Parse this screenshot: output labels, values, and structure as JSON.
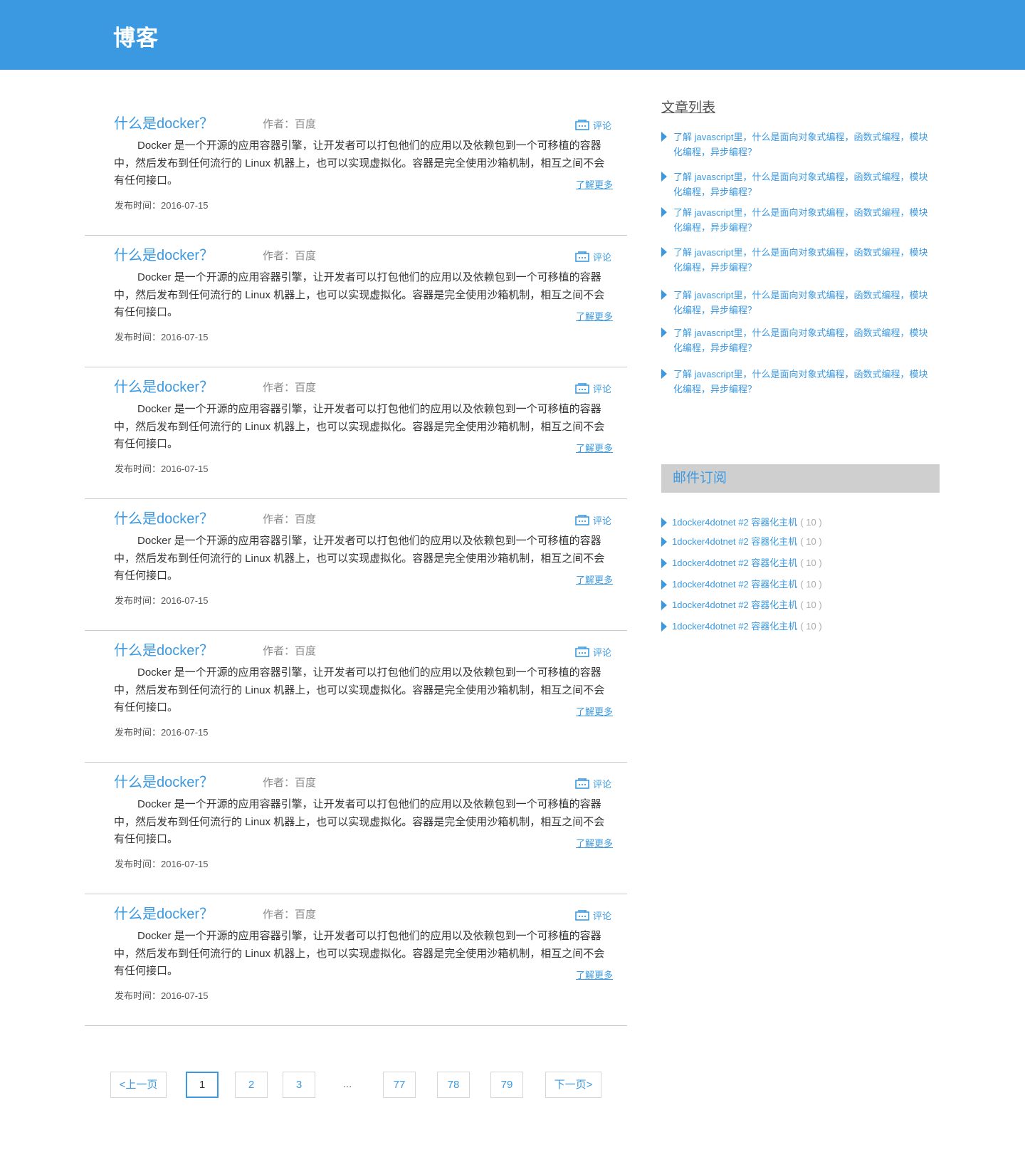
{
  "header": {
    "site_title": "博客"
  },
  "posts": [
    {
      "title": "什么是docker？",
      "author": "作者：百度",
      "comment_label": "评论",
      "excerpt": "Docker 是一个开源的应用容器引擎，让开发者可以打包他们的应用以及依赖包到一个可移植的容器中，然后发布到任何流行的 Linux 机器上，也可以实现虚拟化。容器是完全使用沙箱机制，相互之间不会有任何接口。",
      "more_label": "了解更多",
      "date": "发布时间：2016-07-15"
    },
    {
      "title": "什么是docker？",
      "author": "作者：百度",
      "comment_label": "评论",
      "excerpt": "Docker 是一个开源的应用容器引擎，让开发者可以打包他们的应用以及依赖包到一个可移植的容器中，然后发布到任何流行的 Linux 机器上，也可以实现虚拟化。容器是完全使用沙箱机制，相互之间不会有任何接口。",
      "more_label": "了解更多",
      "date": "发布时间：2016-07-15"
    },
    {
      "title": "什么是docker？",
      "author": "作者：百度",
      "comment_label": "评论",
      "excerpt": "Docker 是一个开源的应用容器引擎，让开发者可以打包他们的应用以及依赖包到一个可移植的容器中，然后发布到任何流行的 Linux 机器上，也可以实现虚拟化。容器是完全使用沙箱机制，相互之间不会有任何接口。",
      "more_label": "了解更多",
      "date": "发布时间：2016-07-15"
    },
    {
      "title": "什么是docker？",
      "author": "作者：百度",
      "comment_label": "评论",
      "excerpt": "Docker 是一个开源的应用容器引擎，让开发者可以打包他们的应用以及依赖包到一个可移植的容器中，然后发布到任何流行的 Linux 机器上，也可以实现虚拟化。容器是完全使用沙箱机制，相互之间不会有任何接口。",
      "more_label": "了解更多",
      "date": "发布时间：2016-07-15"
    },
    {
      "title": "什么是docker？",
      "author": "作者：百度",
      "comment_label": "评论",
      "excerpt": "Docker 是一个开源的应用容器引擎，让开发者可以打包他们的应用以及依赖包到一个可移植的容器中，然后发布到任何流行的 Linux 机器上，也可以实现虚拟化。容器是完全使用沙箱机制，相互之间不会有任何接口。",
      "more_label": "了解更多",
      "date": "发布时间：2016-07-15"
    },
    {
      "title": "什么是docker？",
      "author": "作者：百度",
      "comment_label": "评论",
      "excerpt": "Docker 是一个开源的应用容器引擎，让开发者可以打包他们的应用以及依赖包到一个可移植的容器中，然后发布到任何流行的 Linux 机器上，也可以实现虚拟化。容器是完全使用沙箱机制，相互之间不会有任何接口。",
      "more_label": "了解更多",
      "date": "发布时间：2016-07-15"
    },
    {
      "title": "什么是docker？",
      "author": "作者：百度",
      "comment_label": "评论",
      "excerpt": "Docker 是一个开源的应用容器引擎，让开发者可以打包他们的应用以及依赖包到一个可移植的容器中，然后发布到任何流行的 Linux 机器上，也可以实现虚拟化。容器是完全使用沙箱机制，相互之间不会有任何接口。",
      "more_label": "了解更多",
      "date": "发布时间：2016-07-15"
    }
  ],
  "pagination": {
    "prev_label": "<上一页",
    "next_label": "下一页>",
    "pages": [
      "1",
      "2",
      "3",
      "...",
      "77",
      "78",
      "79"
    ],
    "current": "1"
  },
  "sidebar": {
    "articles_heading": "文章列表",
    "articles": [
      "了解 javascript里，什么是面向对象式编程，函数式编程，模块化编程，异步编程？",
      "了解 javascript里，什么是面向对象式编程，函数式编程，模块化编程，异步编程？",
      "了解 javascript里，什么是面向对象式编程，函数式编程，模块化编程，异步编程？",
      "了解 javascript里，什么是面向对象式编程，函数式编程，模块化编程，异步编程？",
      "了解 javascript里，什么是面向对象式编程，函数式编程，模块化编程，异步编程？",
      "了解 javascript里，什么是面向对象式编程，函数式编程，模块化编程，异步编程？",
      "了解 javascript里，什么是面向对象式编程，函数式编程，模块化编程，异步编程？"
    ],
    "subscribe_heading": "邮件订阅",
    "subscriptions": [
      {
        "name": "1docker4dotnet #2 容器化主机",
        "count": "( 10 )"
      },
      {
        "name": "1docker4dotnet #2 容器化主机",
        "count": "( 10 )"
      },
      {
        "name": "1docker4dotnet #2 容器化主机",
        "count": "( 10 )"
      },
      {
        "name": "1docker4dotnet #2 容器化主机",
        "count": "( 10 )"
      },
      {
        "name": "1docker4dotnet #2 容器化主机",
        "count": "( 10 )"
      },
      {
        "name": "1docker4dotnet #2 容器化主机",
        "count": "( 10 )"
      }
    ]
  },
  "colors": {
    "accent": "#3b99e1",
    "header_bg": "#3b99e1",
    "subscribe_bg": "#cfcfcf",
    "divider": "#c9c9c9"
  },
  "icons": {
    "comment": "comment-icon",
    "list_bullet": "triangle-right-icon"
  }
}
